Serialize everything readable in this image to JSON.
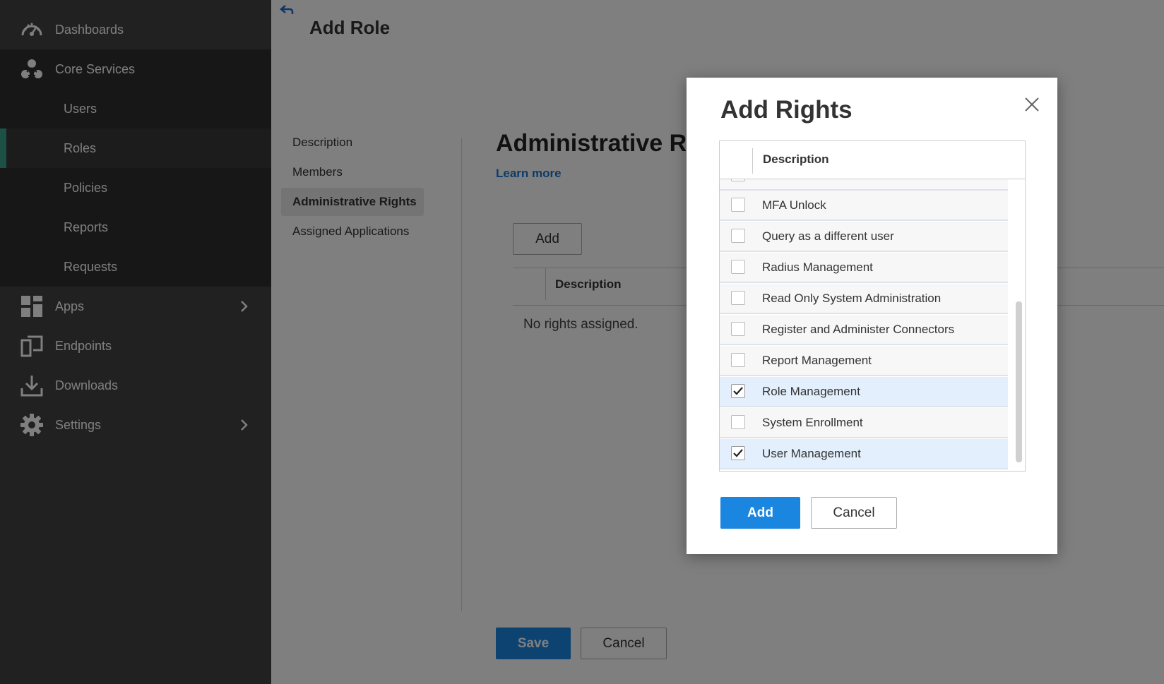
{
  "sidebar": {
    "nav": [
      {
        "label": "Dashboards",
        "icon": "gauge-icon"
      },
      {
        "label": "Core Services",
        "icon": "core-services-icon"
      }
    ],
    "core_sub": [
      {
        "label": "Users"
      },
      {
        "label": "Roles",
        "active": true
      },
      {
        "label": "Policies"
      },
      {
        "label": "Reports"
      },
      {
        "label": "Requests"
      }
    ],
    "nav2": [
      {
        "label": "Apps",
        "icon": "apps-grid-icon",
        "chevron": true
      },
      {
        "label": "Endpoints",
        "icon": "endpoints-icon"
      },
      {
        "label": "Downloads",
        "icon": "download-icon"
      },
      {
        "label": "Settings",
        "icon": "gear-icon",
        "chevron": true
      }
    ]
  },
  "main": {
    "title": "Add Role",
    "tabs": [
      "Description",
      "Members",
      "Administrative Rights",
      "Assigned Applications"
    ],
    "active_tab": "Administrative Rights",
    "section_title": "Administrative R",
    "learn_more": "Learn more",
    "add_label": "Add",
    "table_header": "Description",
    "empty_message": "No rights assigned.",
    "save_label": "Save",
    "cancel_label": "Cancel"
  },
  "dialog": {
    "title": "Add Rights",
    "column_header": "Description",
    "rows": [
      {
        "label": "MFA Unlock",
        "checked": false
      },
      {
        "label": "Query as a different user",
        "checked": false
      },
      {
        "label": "Radius Management",
        "checked": false
      },
      {
        "label": "Read Only System Administration",
        "checked": false
      },
      {
        "label": "Register and Administer Connectors",
        "checked": false
      },
      {
        "label": "Report Management",
        "checked": false
      },
      {
        "label": "Role Management",
        "checked": true
      },
      {
        "label": "System Enrollment",
        "checked": false
      },
      {
        "label": "User Management",
        "checked": true
      }
    ],
    "add_label": "Add",
    "cancel_label": "Cancel"
  },
  "colors": {
    "accent": "#1a86e0",
    "sidebar_bg": "#424242",
    "active_indicator": "#3aa38b",
    "link": "#1976d2"
  }
}
